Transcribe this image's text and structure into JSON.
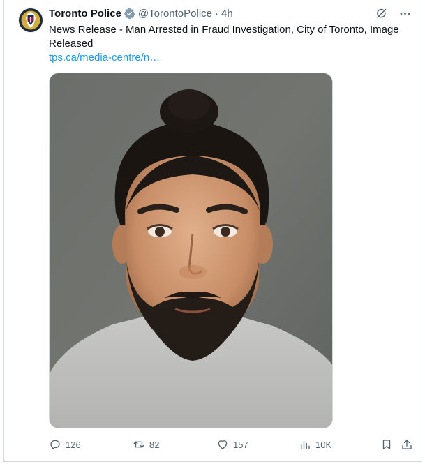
{
  "tweet": {
    "display_name": "Toronto Police",
    "handle": "@TorontoPolice",
    "separator": "·",
    "time": "4h",
    "text": "News Release - Man Arrested in Fraud Investigation, City of Toronto, Image Released",
    "link": "tps.ca/media-centre/n…",
    "avatar_icon": "toronto-police-badge-icon",
    "verified_icon": "verified-badge-icon",
    "media_description_icon": "mugshot-image"
  },
  "top_actions": {
    "grok_icon": "grok-icon",
    "more_icon": "more-icon"
  },
  "actions": {
    "replies": "126",
    "reposts": "82",
    "likes": "157",
    "views": "10K"
  },
  "colors": {
    "link": "#1d9bf0",
    "secondary_text": "#536471",
    "border": "#cfd9de",
    "verified_badge": "#829aab"
  }
}
